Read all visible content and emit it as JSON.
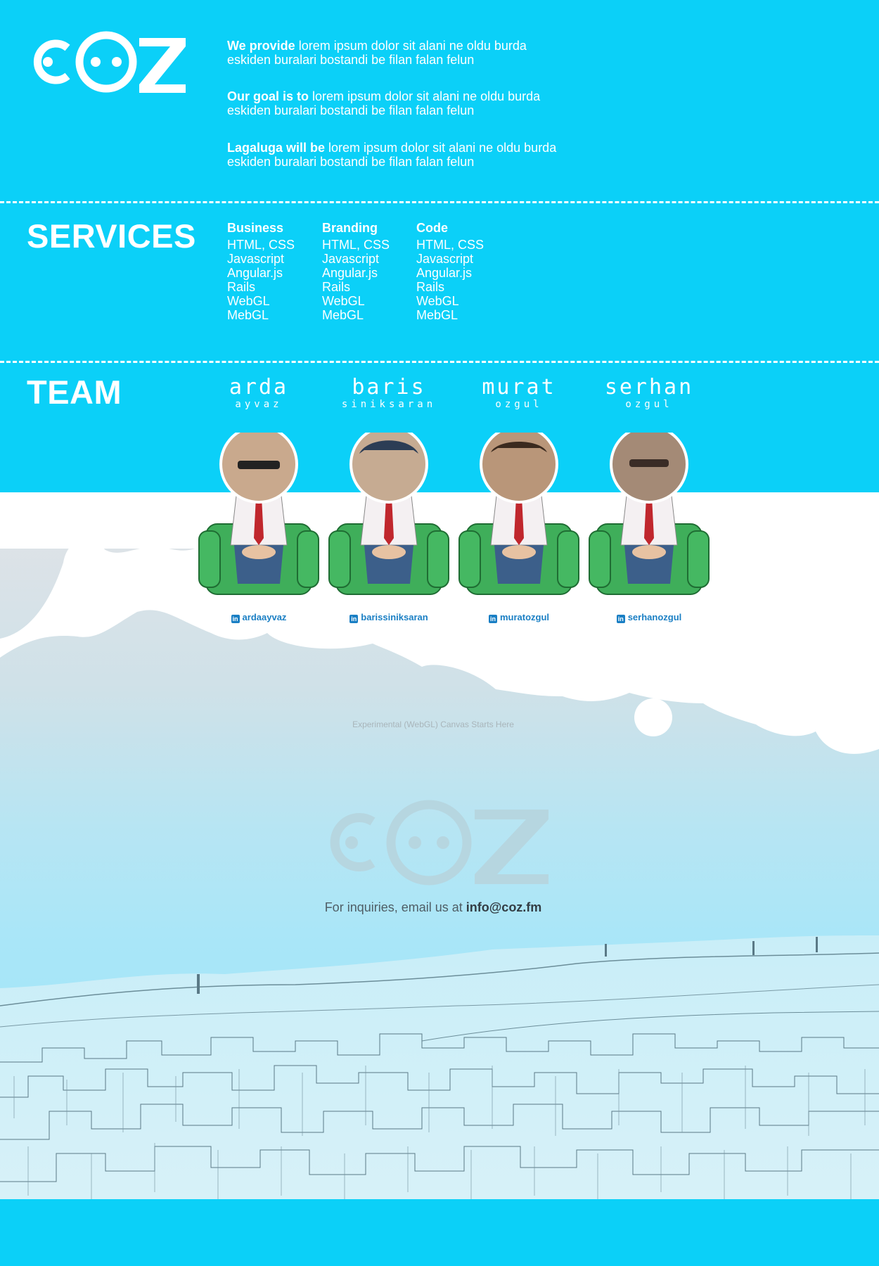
{
  "brand": {
    "logo_text": "COZ"
  },
  "intro": [
    {
      "lead": "We provide",
      "text": " lorem ipsum dolor sit alani ne oldu burda",
      "text2": "eskiden buralari bostandi be filan falan felun"
    },
    {
      "lead": "Our goal is to",
      "text": " lorem ipsum dolor sit alani ne oldu burda",
      "text2": "eskiden buralari bostandi be filan falan felun"
    },
    {
      "lead": "Lagaluga will be",
      "text": " lorem ipsum dolor sit alani ne oldu burda",
      "text2": "eskiden buralari bostandi be filan falan felun"
    }
  ],
  "services": {
    "title": "SERVICES",
    "columns": [
      {
        "heading": "Business",
        "items": [
          "HTML, CSS",
          "Javascript",
          "Angular.js",
          "Rails",
          "WebGL",
          "MebGL"
        ]
      },
      {
        "heading": "Branding",
        "items": [
          "HTML, CSS",
          "Javascript",
          "Angular.js",
          "Rails",
          "WebGL",
          "MebGL"
        ]
      },
      {
        "heading": "Code",
        "items": [
          "HTML, CSS",
          "Javascript",
          "Angular.js",
          "Rails",
          "WebGL",
          "MebGL"
        ]
      }
    ]
  },
  "team": {
    "title": "TEAM",
    "members": [
      {
        "first": "arda",
        "last": "ayvaz",
        "linkedin": "ardaayvaz"
      },
      {
        "first": "baris",
        "last": "siniksaran",
        "linkedin": "barissiniksaran"
      },
      {
        "first": "murat",
        "last": "ozgul",
        "linkedin": "muratozgul"
      },
      {
        "first": "serhan",
        "last": "ozgul",
        "linkedin": "serhanozgul"
      }
    ]
  },
  "canvas_note": "Experimental (WebGL) Canvas Starts Here",
  "contact": {
    "prefix": "For inquiries, email us at ",
    "email": "info@coz.fm"
  },
  "colors": {
    "primary": "#0bd0f8",
    "white": "#ffffff",
    "linkedin": "#1a7fc4",
    "chair": "#3fae5a",
    "tie": "#c0272d"
  },
  "icons": {
    "linkedin": "linkedin-icon"
  }
}
